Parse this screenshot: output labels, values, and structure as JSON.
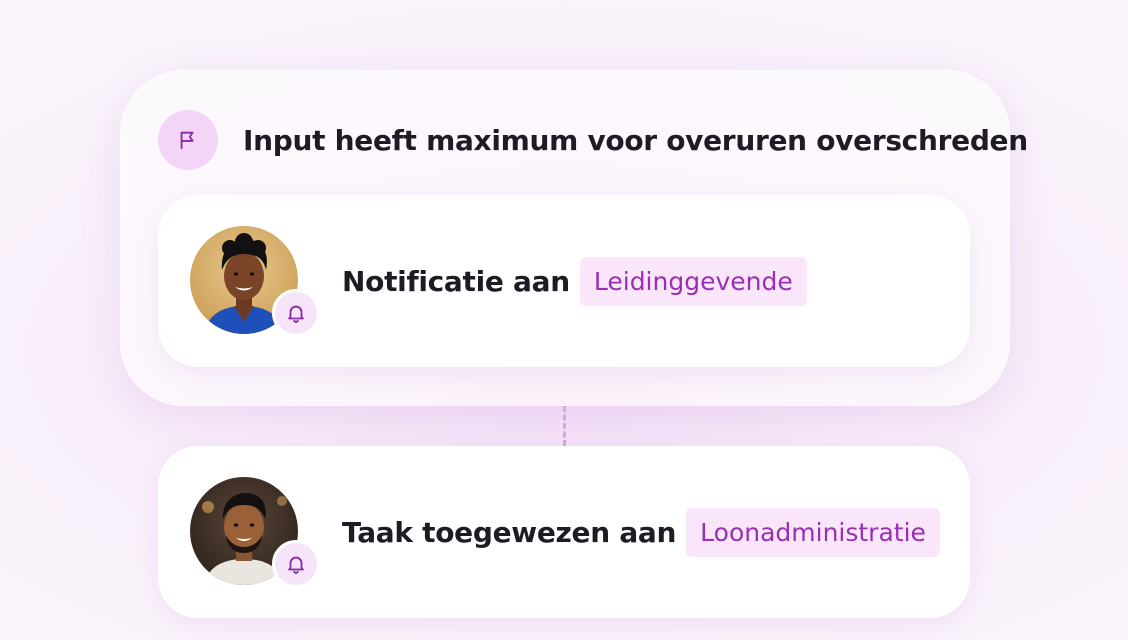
{
  "trigger": {
    "title": "Input heeft maximum voor overuren overschreden",
    "icon": "flag-icon"
  },
  "actions": [
    {
      "text": "Notificatie aan",
      "tag": "Leidinggevende",
      "avatar": "woman-avatar",
      "badge_icon": "bell-icon"
    },
    {
      "text": "Taak toegewezen aan",
      "tag": "Loonadministratie",
      "avatar": "man-avatar",
      "badge_icon": "bell-icon"
    }
  ],
  "colors": {
    "accent": "#9a2fb4",
    "tag_bg": "#f9e6fb",
    "badge_bg": "#f3d6f7"
  }
}
